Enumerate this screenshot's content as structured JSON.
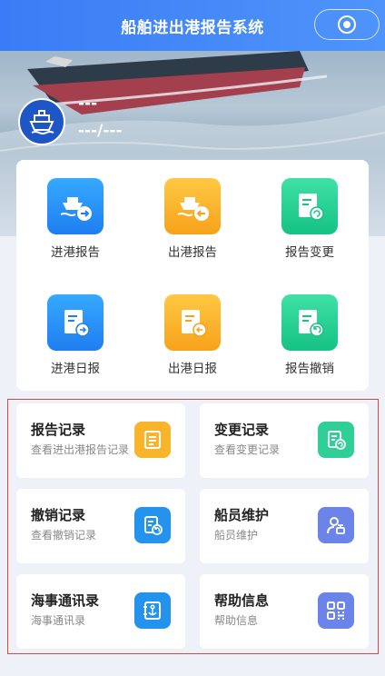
{
  "header": {
    "title": "船舶进出港报告系统"
  },
  "vessel": {
    "name": "---",
    "sub": "---/---"
  },
  "grid": [
    {
      "label": "进港报告",
      "icon": "ship-arrival-icon"
    },
    {
      "label": "出港报告",
      "icon": "ship-departure-icon"
    },
    {
      "label": "报告变更",
      "icon": "report-change-icon"
    },
    {
      "label": "进港日报",
      "icon": "daily-arrival-icon"
    },
    {
      "label": "出港日报",
      "icon": "daily-departure-icon"
    },
    {
      "label": "报告撤销",
      "icon": "report-cancel-icon"
    }
  ],
  "tiles": [
    {
      "title": "报告记录",
      "desc": "查看进出港报告记录",
      "icon": "document-icon"
    },
    {
      "title": "变更记录",
      "desc": "查看变更记录",
      "icon": "change-record-icon"
    },
    {
      "title": "撤销记录",
      "desc": "查看撤销记录",
      "icon": "cancel-record-icon"
    },
    {
      "title": "船员维护",
      "desc": "船员维护",
      "icon": "crew-icon"
    },
    {
      "title": "海事通讯录",
      "desc": "海事通讯录",
      "icon": "anchor-contacts-icon"
    },
    {
      "title": "帮助信息",
      "desc": "帮助信息",
      "icon": "help-grid-icon"
    }
  ],
  "colors": {
    "header": "#3a7cf5",
    "blue": "#1f7ef0",
    "orange": "#f7a21b",
    "green": "#15c383",
    "highlight_border": "#e0463f"
  }
}
